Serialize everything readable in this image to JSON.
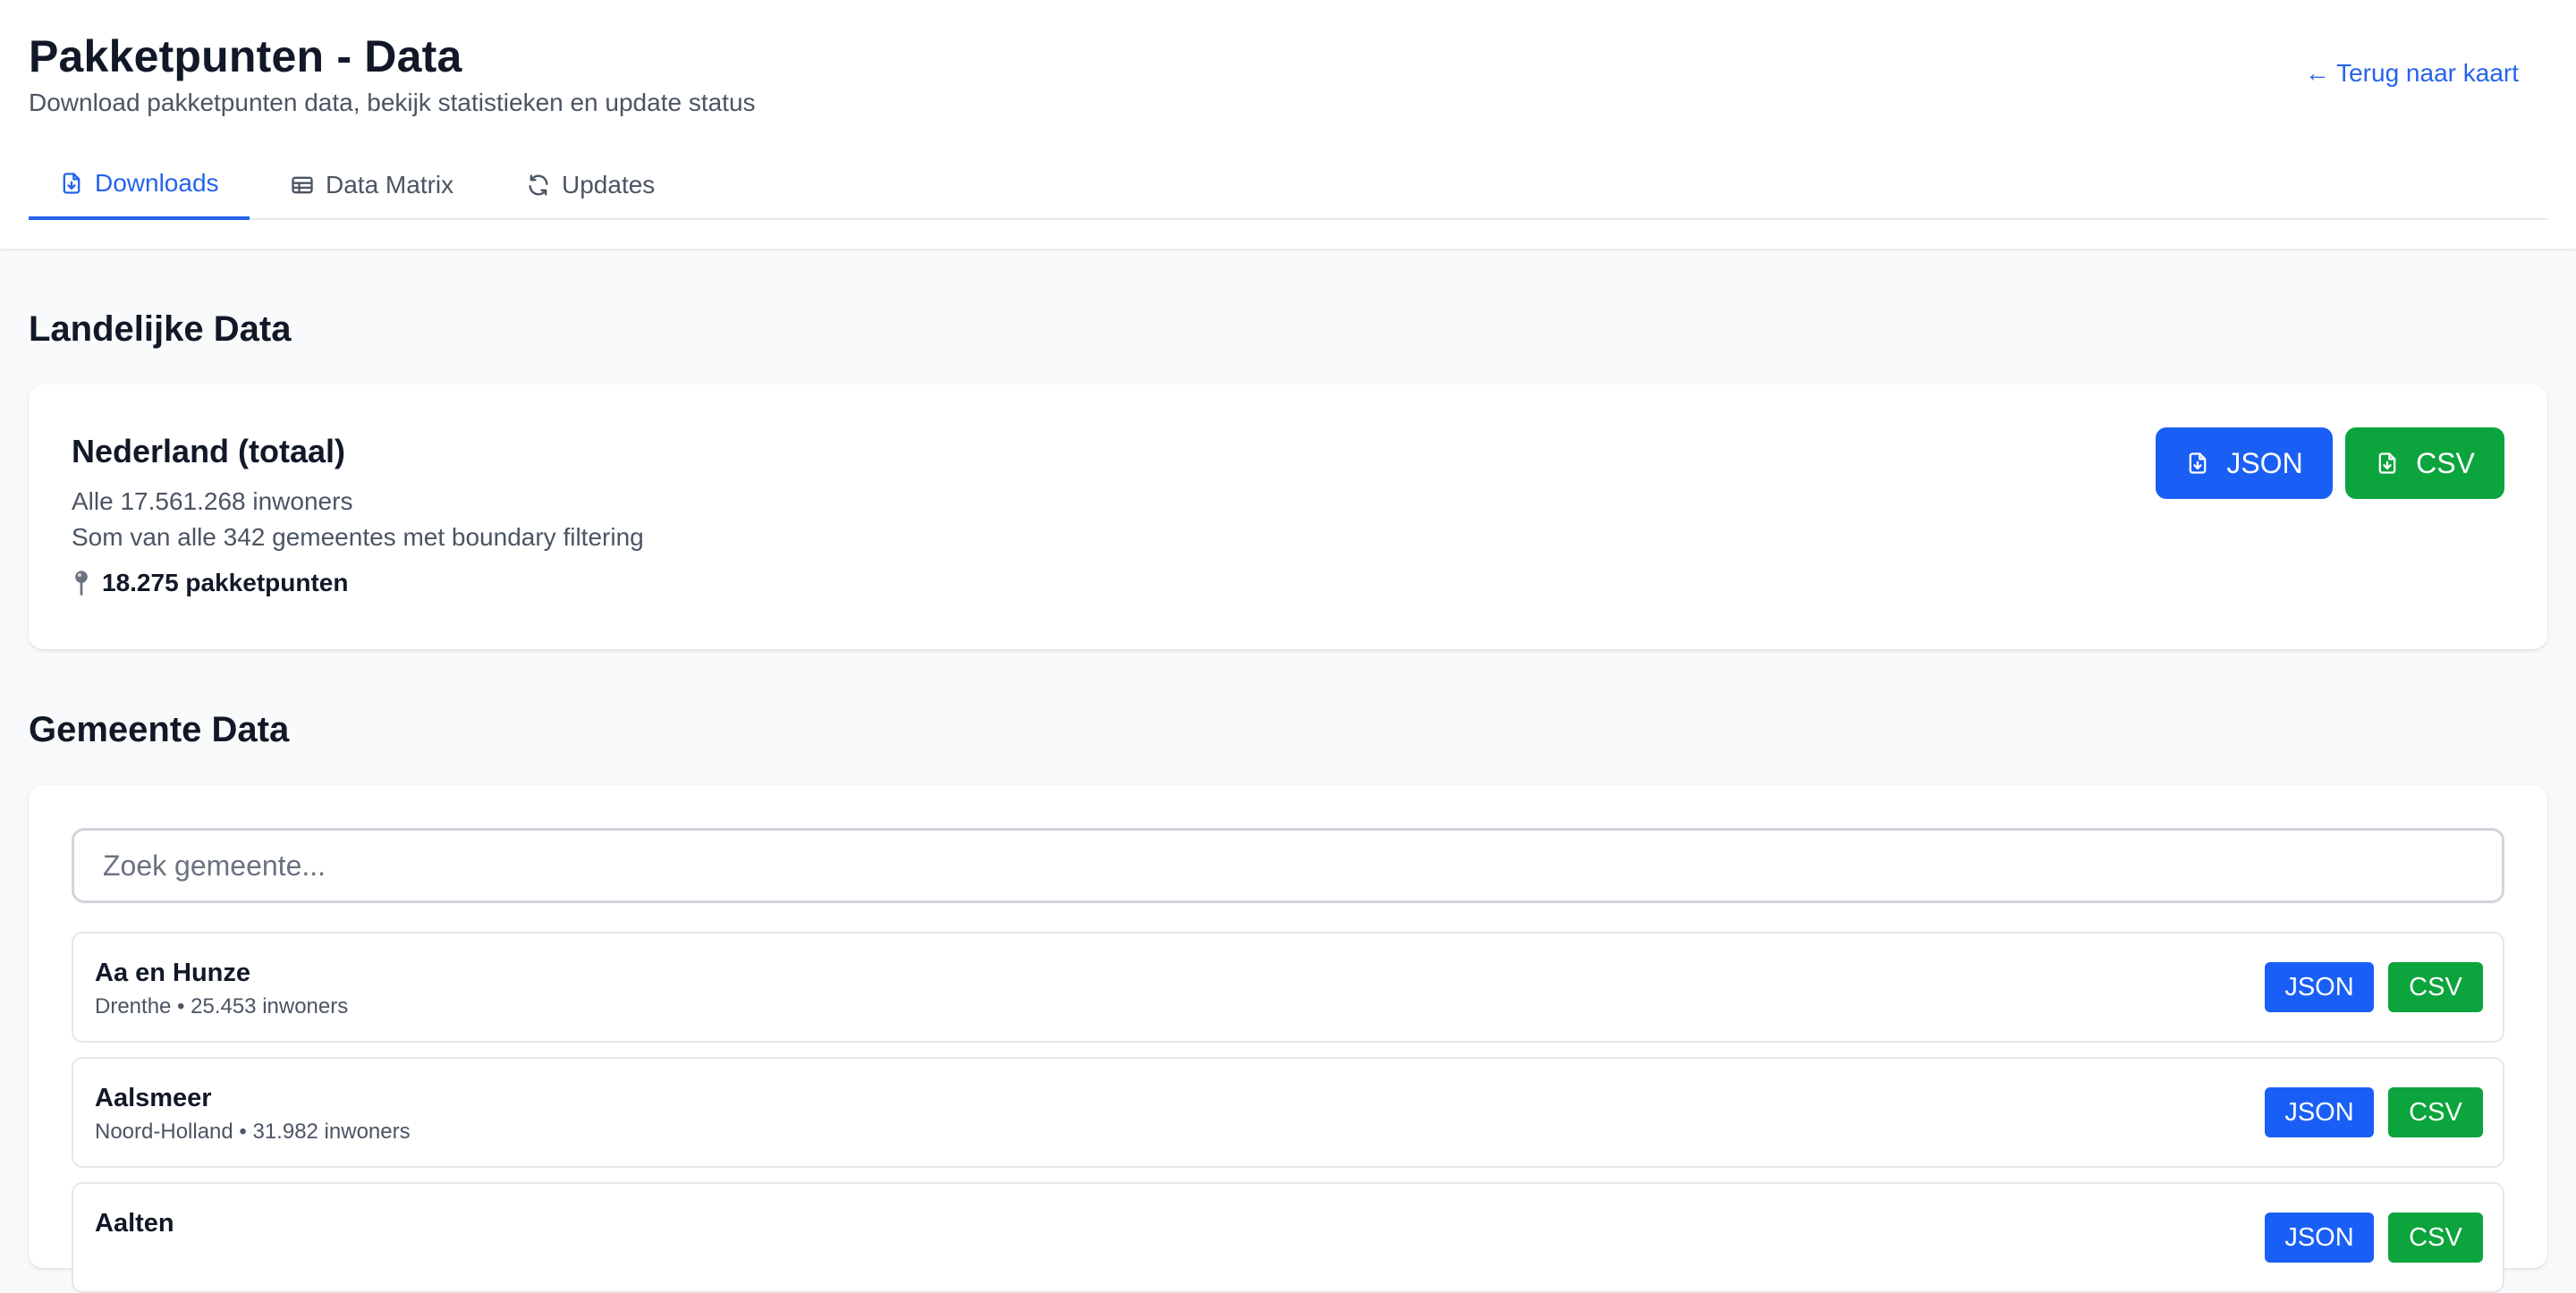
{
  "header": {
    "title": "Pakketpunten - Data",
    "subtitle": "Download pakketpunten data, bekijk statistieken en update status",
    "back_link": "← Terug naar kaart"
  },
  "tabs": [
    {
      "label": "Downloads",
      "icon": "file-download-icon",
      "active": true
    },
    {
      "label": "Data Matrix",
      "icon": "table-icon",
      "active": false
    },
    {
      "label": "Updates",
      "icon": "refresh-icon",
      "active": false
    }
  ],
  "national": {
    "section_title": "Landelijke Data",
    "name": "Nederland (totaal)",
    "line1": "Alle 17.561.268 inwoners",
    "line2": "Som van alle 342 gemeentes met boundary filtering",
    "count": "18.275 pakketpunten",
    "json_label": "JSON",
    "csv_label": "CSV"
  },
  "municipal": {
    "section_title": "Gemeente Data",
    "search_placeholder": "Zoek gemeente...",
    "rows": [
      {
        "name": "Aa en Hunze",
        "sub": "Drenthe • 25.453 inwoners",
        "json": "JSON",
        "csv": "CSV"
      },
      {
        "name": "Aalsmeer",
        "sub": "Noord-Holland • 31.982 inwoners",
        "json": "JSON",
        "csv": "CSV"
      },
      {
        "name": "Aalten",
        "sub": "",
        "json": "JSON",
        "csv": "CSV"
      }
    ]
  },
  "colors": {
    "accent_blue": "#1a5ff5",
    "accent_green": "#0ca43d",
    "link_blue": "#2563eb"
  }
}
